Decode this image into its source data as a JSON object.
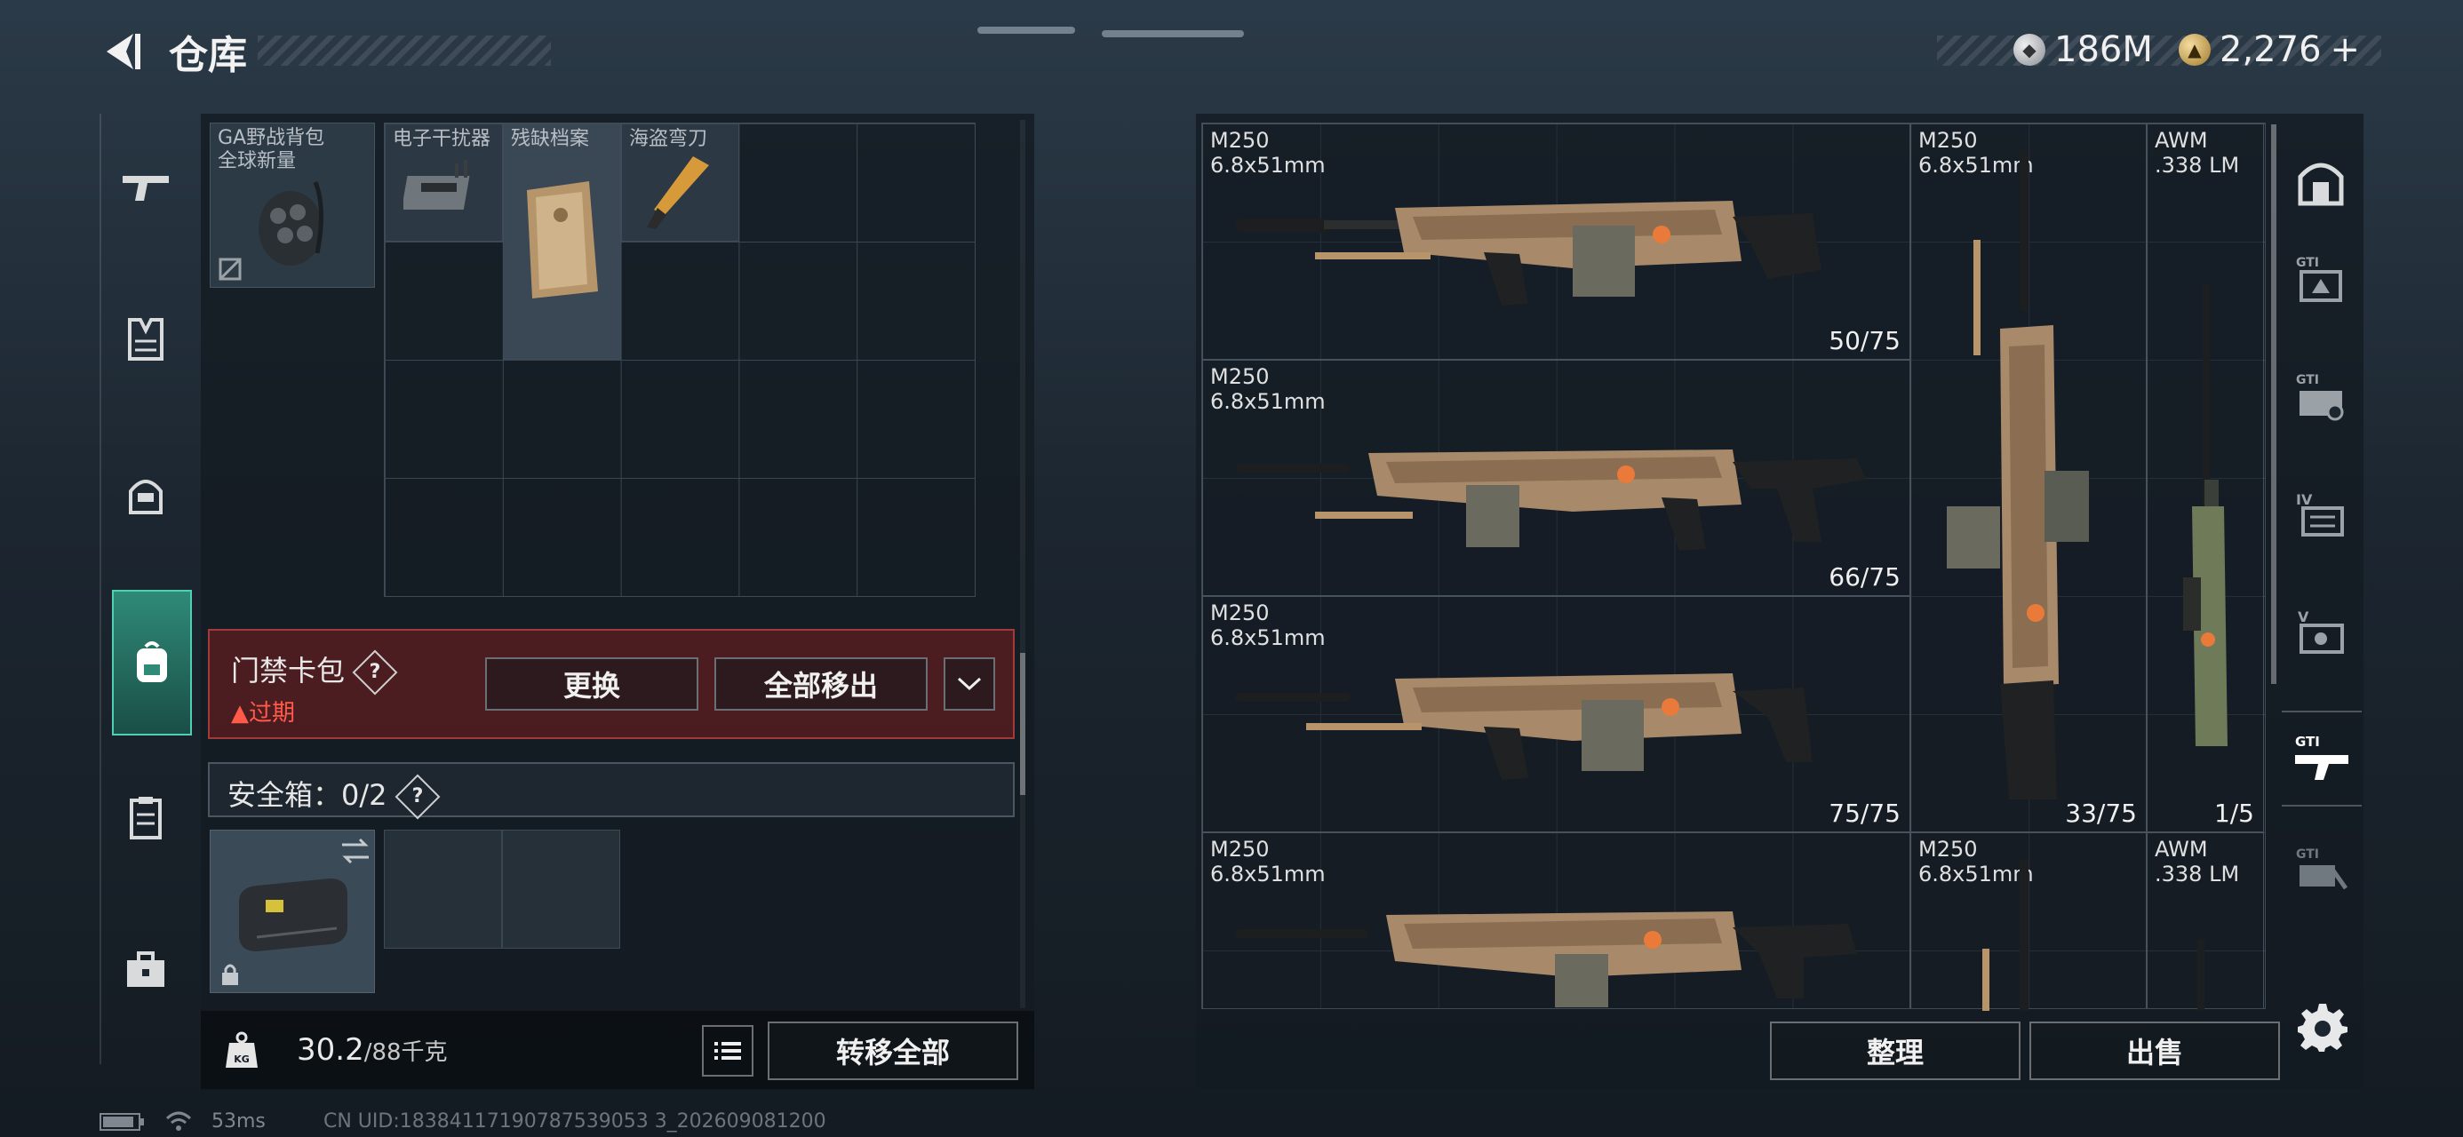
{
  "header": {
    "title": "仓库"
  },
  "currency": [
    {
      "icon": "silver-coin-icon",
      "value": "186M"
    },
    {
      "icon": "gold-coin-icon",
      "value": "2,276",
      "plus": "+"
    }
  ],
  "left_nav": [
    {
      "icon": "gun-icon"
    },
    {
      "icon": "armor-vest-icon"
    },
    {
      "icon": "helmet-icon"
    },
    {
      "icon": "backpack-icon",
      "active": true
    },
    {
      "icon": "clipboard-icon"
    },
    {
      "icon": "briefcase-icon"
    }
  ],
  "backpack": {
    "name_line1": "GA野战背包",
    "name_line2": "全球新量"
  },
  "grid_items": [
    {
      "name": "电子干扰器"
    },
    {
      "name": "残缺档案"
    },
    {
      "name": "海盗弯刀"
    }
  ],
  "keycard": {
    "label": "门禁卡包",
    "help": "?",
    "status": "▲过期",
    "replace_button": "更换",
    "move_all_button": "全部移出"
  },
  "safe_box": {
    "label": "安全箱：0/2",
    "help": "?"
  },
  "bottom_left": {
    "weight": "30.2",
    "capacity": "/88千克",
    "kg_label": "KG",
    "transfer_all": "转移全部"
  },
  "weapons": [
    {
      "name": "M250\n6.8x51mm",
      "count": "50/75"
    },
    {
      "name": "M250\n6.8x51mm",
      "count": "66/75"
    },
    {
      "name": "M250\n6.8x51mm",
      "count": "75/75"
    },
    {
      "name": "M250\n6.8x51mm",
      "count": ""
    },
    {
      "name": "M250\n6.8x51mm",
      "count": "33/75"
    },
    {
      "name": "AWM\n.338 LM",
      "count": "1/5"
    },
    {
      "name": "M250\n6.8x51mm",
      "count": ""
    },
    {
      "name": "AWM\n.338 LM",
      "count": ""
    }
  ],
  "right_nav": [
    {
      "icon": "vault-icon"
    },
    {
      "icon": "gti-tab-1-icon",
      "label": "GTI"
    },
    {
      "icon": "gti-tab-2-icon",
      "label": "GTI"
    },
    {
      "icon": "tab-iv-icon",
      "label": "IV"
    },
    {
      "icon": "tab-v-icon",
      "label": "V"
    },
    {
      "icon": "gti-weapon-icon",
      "label": "GTI",
      "active": true
    },
    {
      "icon": "gti-tab-3-icon",
      "label": "GTI"
    }
  ],
  "bottom_right": {
    "sort_button": "整理",
    "sell_button": "出售"
  },
  "status_bar": {
    "ping": "53ms",
    "uid": "CN UID:18384117190787539053 3_202609081200"
  }
}
